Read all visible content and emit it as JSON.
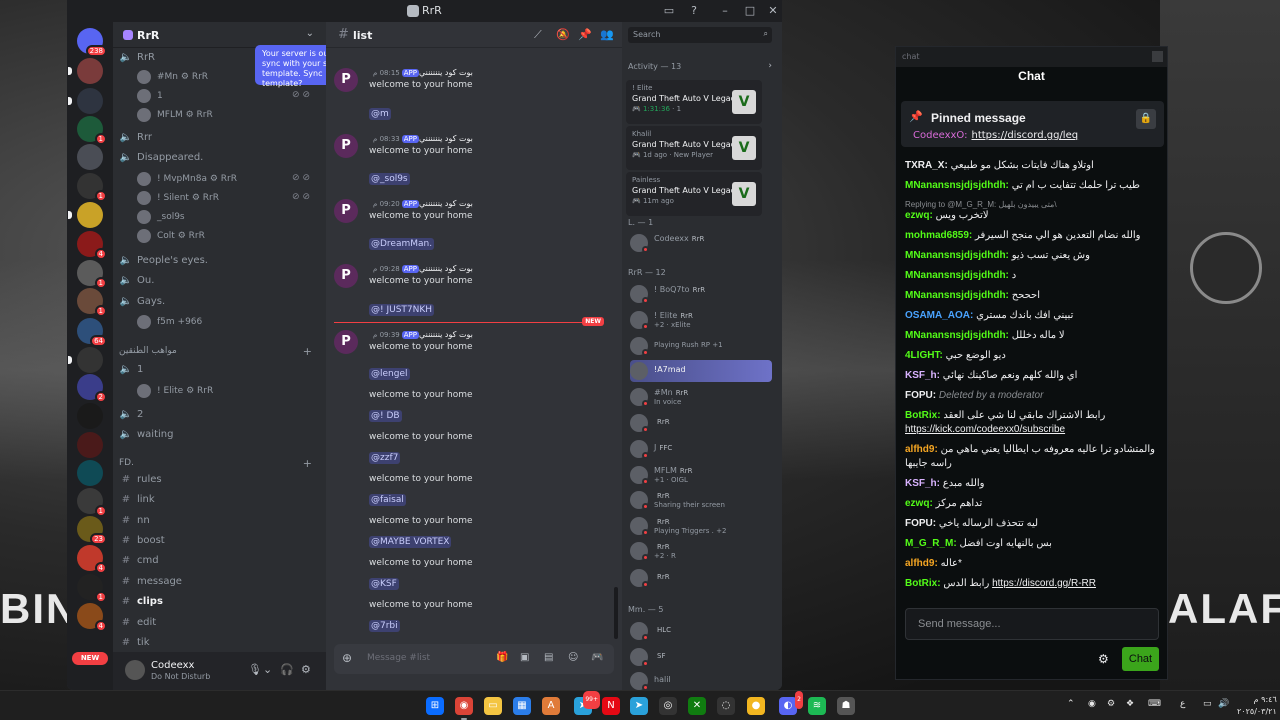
{
  "discord": {
    "window_title": "RrR",
    "server": {
      "name": "RrR"
    },
    "tooltip": "Your server is out of sync with your server template. Sync template?",
    "guild_badges": [
      "238",
      "1",
      "1",
      "4",
      "1",
      "1",
      "3",
      "64",
      "2",
      "1",
      "2",
      "23",
      "4",
      "1",
      "4"
    ],
    "new_label": "NEW",
    "channels": [
      {
        "kind": "voice",
        "label": "RrR"
      },
      {
        "kind": "user",
        "label": "#Mn",
        "tag": "RrR"
      },
      {
        "kind": "user",
        "label": "1",
        "tag": ""
      },
      {
        "kind": "user",
        "label": "MFLM",
        "tag": "RrR"
      },
      {
        "kind": "voice",
        "label": "Rrr"
      },
      {
        "kind": "voice",
        "label": "Disappeared."
      },
      {
        "kind": "user",
        "label": "! MvpMn8a",
        "tag": "RrR"
      },
      {
        "kind": "user",
        "label": "! Silent",
        "tag": "RrR"
      },
      {
        "kind": "user",
        "label": "_sol9s",
        "tag": ""
      },
      {
        "kind": "user",
        "label": "Colt",
        "tag": "RrR"
      },
      {
        "kind": "voice",
        "label": "People's eyes."
      },
      {
        "kind": "voice",
        "label": "Ou."
      },
      {
        "kind": "voice",
        "label": "Gays."
      },
      {
        "kind": "user",
        "label": "f5m +966",
        "tag": ""
      },
      {
        "kind": "category",
        "label": "مواهب الطنقين"
      },
      {
        "kind": "voice",
        "label": "1"
      },
      {
        "kind": "user",
        "label": "! Elite",
        "tag": "RrR"
      },
      {
        "kind": "voice",
        "label": "2"
      },
      {
        "kind": "voice",
        "label": "waiting"
      },
      {
        "kind": "category",
        "label": "FD."
      },
      {
        "kind": "text",
        "label": "rules"
      },
      {
        "kind": "text",
        "label": "link"
      },
      {
        "kind": "text",
        "label": "nn"
      },
      {
        "kind": "text",
        "label": "boost"
      },
      {
        "kind": "text",
        "label": "cmd"
      },
      {
        "kind": "text",
        "label": "message"
      },
      {
        "kind": "text",
        "label": "clips"
      },
      {
        "kind": "text",
        "label": "edit"
      },
      {
        "kind": "text",
        "label": "tik"
      }
    ],
    "user_panel": {
      "name": "Codeexx",
      "status": "Do Not Disturb"
    },
    "channel": {
      "name": "list",
      "composer_placeholder": "Message #list",
      "new_label": "NEW",
      "messages": [
        {
          "author": "بوت كود ينننننني",
          "badge": "APP",
          "time": "08:15 م",
          "text": "welcome to your home"
        },
        {
          "author": "بوت كود ينننننني",
          "badge": "APP",
          "time": "08:33 م",
          "text": "welcome to your home"
        },
        {
          "author": "بوت كود ينننننني",
          "badge": "APP",
          "time": "09:20 م",
          "text": "welcome to your home"
        },
        {
          "author": "بوت كود ينننننني",
          "badge": "APP",
          "time": "09:28 م",
          "text": "welcome to your home"
        },
        {
          "author": "بوت كود ينننننني",
          "badge": "APP",
          "time": "09:39 م",
          "text": "welcome to your home"
        }
      ],
      "mentions": [
        "@m",
        "@_sol9s",
        "@DreamMan.",
        "@!    JUST7NKH",
        "@lengel",
        "@! DB",
        "@zzf7",
        "@faisal",
        "@MAYBE VORTEX",
        "@KSF",
        "@7rbi"
      ],
      "welcome": "welcome to your home"
    },
    "members": {
      "search_placeholder": "Search",
      "activity_label": "Activity — 13",
      "activity_cards": [
        {
          "user": "! Elite",
          "game": "Grand Theft Auto V Legacy",
          "meta": "1:31:36",
          "extra": "1"
        },
        {
          "user": "Khalil",
          "game": "Grand Theft Auto V Legacy",
          "meta": "1d ago",
          "extra": "New Player"
        },
        {
          "user": "Painless",
          "game": "Grand Theft Auto V Legacy",
          "meta": "11m ago",
          "extra": ""
        }
      ],
      "sections": [
        {
          "label": "L. — 1",
          "members": [
            {
              "name": "Codeexx",
              "tag": "RrR",
              "sub": ""
            }
          ]
        },
        {
          "label": "RrR — 12",
          "members": [
            {
              "name": "! BoQ7to",
              "tag": "RrR",
              "sub": ""
            },
            {
              "name": "! Elite",
              "tag": "RrR",
              "sub": "+2 · xElite"
            },
            {
              "name": "",
              "tag": "",
              "sub": "Playing Rush RP +1"
            },
            {
              "name": "!A7mad",
              "tag": "",
              "sub": ""
            },
            {
              "name": "#Mn",
              "tag": "RrR",
              "sub": "In voice"
            },
            {
              "name": "",
              "tag": "RrR",
              "sub": ""
            },
            {
              "name": "J",
              "tag": "FFC",
              "sub": ""
            },
            {
              "name": "MFLM",
              "tag": "RrR",
              "sub": "+1 · OIGL"
            },
            {
              "name": "",
              "tag": "RrR",
              "sub": "Sharing their screen"
            },
            {
              "name": "",
              "tag": "RrR",
              "sub": "Playing Triggers . +2"
            },
            {
              "name": "",
              "tag": "RrR",
              "sub": "+2 · R"
            },
            {
              "name": "",
              "tag": "RrR",
              "sub": ""
            }
          ]
        },
        {
          "label": "Mm. — 5",
          "members": [
            {
              "name": "",
              "tag": "HLC",
              "sub": ""
            },
            {
              "name": "",
              "tag": "SF",
              "sub": ""
            },
            {
              "name": "halil",
              "tag": "",
              "sub": ""
            }
          ]
        }
      ]
    }
  },
  "kick": {
    "window_label": "chat",
    "title": "Chat",
    "pinned": {
      "label": "Pinned message",
      "user": "CodeexxO:",
      "link": "https://discord.gg/leq"
    },
    "messages": [
      {
        "user": "TXRA_X:",
        "color": "#efeff1",
        "text": "اوتلاو هناك فايتات بشكل مو طبيعي"
      },
      {
        "user": "MNanansnsjdjsjdhdh:",
        "color": "#53fc18",
        "text": "طيب ترا حلمك تتفايت ب ام تي"
      },
      {
        "reply": "Replying to @M_G_R_M: متى يبيدون بلهيل\\"
      },
      {
        "user": "ezwq:",
        "color": "#53fc18",
        "text": "لاتخرب ويس"
      },
      {
        "user": "mohmad6859:",
        "color": "#53fc18",
        "text": "والله نضام التعدين هو الي منجح السيرفر"
      },
      {
        "user": "MNanansnsjdjsjdhdh:",
        "color": "#53fc18",
        "text": "وش يعني تسب ذيو"
      },
      {
        "user": "MNanansnsjdjsjdhdh:",
        "color": "#53fc18",
        "text": "د"
      },
      {
        "user": "MNanansnsjdjsjdhdh:",
        "color": "#53fc18",
        "text": "احححح"
      },
      {
        "user": "OSAMA_AOA:",
        "color": "#4aa3ff",
        "text": "تبيني افك باندك مستري"
      },
      {
        "user": "MNanansnsjdjsjdhdh:",
        "color": "#53fc18",
        "text": "لا ماله دخللل"
      },
      {
        "user": "4LIGHT:",
        "color": "#53fc18",
        "text": "ديو الوضع حبي"
      },
      {
        "user": "KSF_h:",
        "color": "#d9b3ff",
        "text": "اي والله كلهم ونعم صاكينك نهائي"
      },
      {
        "user": "FOPU:",
        "color": "#efeff1",
        "deleted": "Deleted by a moderator"
      },
      {
        "user": "BotRix:",
        "color": "#53fc18",
        "text": "رابط الاشتراك مابقي لنا شي على العقد",
        "link": "https://kick.com/codeexx0/subscribe"
      },
      {
        "user": "alfhd9:",
        "color": "#f5a623",
        "text": "والمتشادو ترا عاليه معروفه ب ايطاليا يعني ماهي من راسه جايبها"
      },
      {
        "user": "KSF_h:",
        "color": "#d9b3ff",
        "text": "والله مبدع"
      },
      {
        "user": "ezwq:",
        "color": "#53fc18",
        "text": "تداهم مركز"
      },
      {
        "user": "FOPU:",
        "color": "#efeff1",
        "text": "ليه تتحذف الرساله ياخي"
      },
      {
        "user": "M_G_R_M:",
        "color": "#53fc18",
        "text": "بس بالنهايه اوت افضل"
      },
      {
        "user": "alfhd9:",
        "color": "#f5a623",
        "text": "عاله*"
      },
      {
        "user": "BotRix:",
        "color": "#53fc18",
        "text": "رابط الدس",
        "link": "https://discord.gg/R-RR"
      }
    ],
    "input_placeholder": "Send message...",
    "send_label": "Chat"
  },
  "wallpaper": {
    "left_text": "BIN",
    "right_text": "ALAFI"
  },
  "taskbar": {
    "lang": "ع",
    "time": "٩:٤٦ م",
    "date": "٢٠٢٥/٠٣/٢١",
    "badges": {
      "telegram": "99+",
      "discord": "2"
    }
  }
}
